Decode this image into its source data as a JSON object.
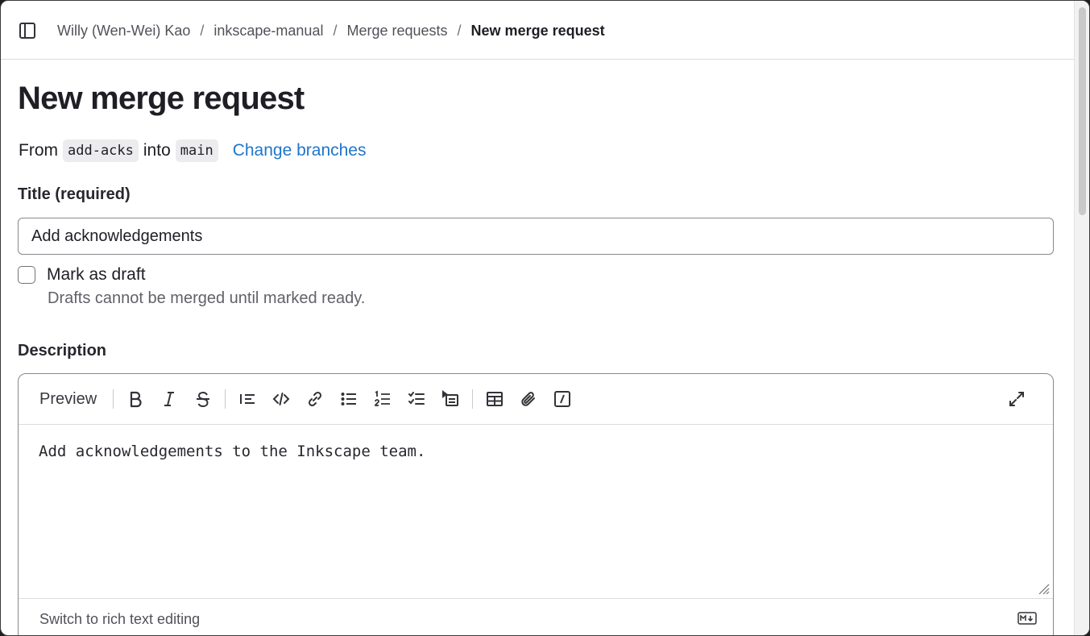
{
  "breadcrumb": {
    "items": [
      "Willy (Wen-Wei) Kao",
      "inkscape-manual",
      "Merge requests"
    ],
    "separator": "/",
    "current": "New merge request"
  },
  "page": {
    "title": "New merge request"
  },
  "branches": {
    "from_label": "From",
    "source": "add-acks",
    "into_label": "into",
    "target": "main",
    "change_link": "Change branches"
  },
  "title_field": {
    "label": "Title (required)",
    "value": "Add acknowledgements"
  },
  "draft": {
    "label": "Mark as draft",
    "help": "Drafts cannot be merged until marked ready.",
    "checked": false
  },
  "description": {
    "label": "Description",
    "preview_label": "Preview",
    "content": "Add acknowledgements to the Inkscape team.",
    "switch_label": "Switch to rich text editing"
  },
  "toolbar_icons": [
    "bold-icon",
    "italic-icon",
    "strikethrough-icon",
    "quote-icon",
    "code-icon",
    "link-icon",
    "bullet-list-icon",
    "numbered-list-icon",
    "task-list-icon",
    "collapsible-icon",
    "table-icon",
    "attach-icon",
    "slash-command-icon",
    "fullscreen-icon",
    "markdown-icon"
  ],
  "colors": {
    "link": "#1f75cb",
    "text": "#1f1e24",
    "muted": "#626168",
    "border": "#89888d"
  }
}
